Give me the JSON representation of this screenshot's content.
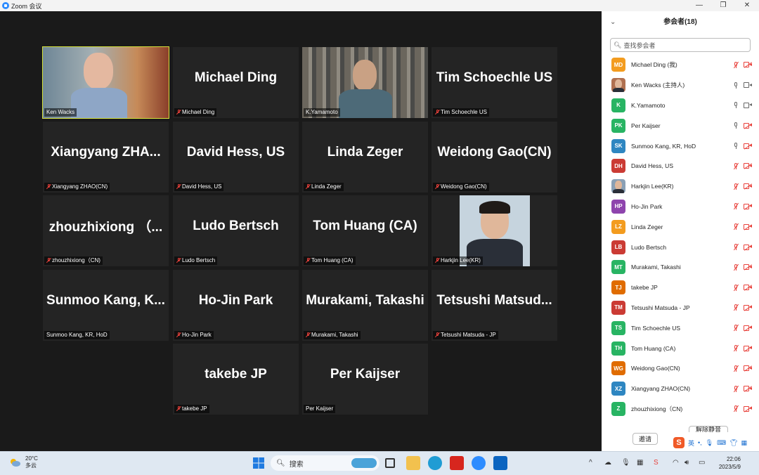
{
  "window": {
    "title": "Zoom 会议",
    "controls": [
      "—",
      "❐",
      "✕"
    ]
  },
  "tiles": [
    {
      "big": "",
      "tag": "Ken Wacks",
      "muted": false,
      "video": "ken"
    },
    {
      "big": "Michael Ding",
      "tag": "Michael Ding",
      "muted": true
    },
    {
      "big": "",
      "tag": "K.Yamamoto",
      "muted": false,
      "video": "yamamoto"
    },
    {
      "big": "Tim Schoechle US",
      "tag": "Tim Schoechle US",
      "muted": true
    },
    {
      "big": "Xiangyang  ZHA...",
      "tag": "Xiangyang ZHAO(CN)",
      "muted": true
    },
    {
      "big": "David Hess, US",
      "tag": "David Hess, US",
      "muted": true
    },
    {
      "big": "Linda Zeger",
      "tag": "Linda Zeger",
      "muted": true
    },
    {
      "big": "Weidong Gao(CN)",
      "tag": "Weidong Gao(CN)",
      "muted": true
    },
    {
      "big": "zhouzhixiong （...",
      "tag": "zhouzhixiong（CN)",
      "muted": true
    },
    {
      "big": "Ludo Bertsch",
      "tag": "Ludo Bertsch",
      "muted": true
    },
    {
      "big": "Tom Huang (CA)",
      "tag": "Tom Huang (CA)",
      "muted": true
    },
    {
      "big": "",
      "tag": "Harkjin Lee(KR)",
      "muted": true,
      "video": "harkjin"
    },
    {
      "big": "Sunmoo  Kang,  K...",
      "tag": "Sunmoo Kang, KR, HoD",
      "muted": false
    },
    {
      "big": "Ho-Jin Park",
      "tag": "Ho-Jin Park",
      "muted": true
    },
    {
      "big": "Murakami, Takashi",
      "tag": "Murakami, Takashi",
      "muted": true
    },
    {
      "big": "Tetsushi  Matsud...",
      "tag": "Tetsushi Matsuda - JP",
      "muted": true
    },
    {
      "big": "takebe JP",
      "tag": "takebe JP",
      "muted": true
    },
    {
      "big": "Per Kaijser",
      "tag": "Per Kaijser",
      "muted": false
    }
  ],
  "sidebar": {
    "title": "参会者(18)",
    "search_placeholder": "查找参会者",
    "participants": [
      {
        "initials": "MD",
        "color": "#f39c1f",
        "name": "Michael Ding (我)",
        "mic": "off",
        "cam": "off"
      },
      {
        "initials": "",
        "color": "#b07050",
        "name": "Ken Wacks (主持人)",
        "mic": "on",
        "cam": "on",
        "photo": true
      },
      {
        "initials": "K",
        "color": "#28b463",
        "name": "K.Yamamoto",
        "mic": "on",
        "cam": "on"
      },
      {
        "initials": "PK",
        "color": "#28b463",
        "name": "Per Kaijser",
        "mic": "on",
        "cam": "off"
      },
      {
        "initials": "SK",
        "color": "#2e86c1",
        "name": "Sunmoo Kang, KR, HoD",
        "mic": "on",
        "cam": "off"
      },
      {
        "initials": "DH",
        "color": "#cb3b34",
        "name": "David Hess, US",
        "mic": "off",
        "cam": "off"
      },
      {
        "initials": "",
        "color": "#8aa0b5",
        "name": "Harkjin Lee(KR)",
        "mic": "off",
        "cam": "off",
        "photo": true
      },
      {
        "initials": "HP",
        "color": "#8e44ad",
        "name": "Ho-Jin Park",
        "mic": "off",
        "cam": "off"
      },
      {
        "initials": "LZ",
        "color": "#f39c1f",
        "name": "Linda Zeger",
        "mic": "off",
        "cam": "off"
      },
      {
        "initials": "LB",
        "color": "#cb3b34",
        "name": "Ludo Bertsch",
        "mic": "off",
        "cam": "off"
      },
      {
        "initials": "MT",
        "color": "#28b463",
        "name": "Murakami, Takashi",
        "mic": "off",
        "cam": "off"
      },
      {
        "initials": "TJ",
        "color": "#e06c00",
        "name": "takebe JP",
        "mic": "off",
        "cam": "off"
      },
      {
        "initials": "TM",
        "color": "#cb3b34",
        "name": "Tetsushi Matsuda - JP",
        "mic": "off",
        "cam": "off"
      },
      {
        "initials": "TS",
        "color": "#28b463",
        "name": "Tim Schoechle US",
        "mic": "off",
        "cam": "off"
      },
      {
        "initials": "TH",
        "color": "#28b463",
        "name": "Tom Huang (CA)",
        "mic": "off",
        "cam": "off"
      },
      {
        "initials": "WG",
        "color": "#e06c00",
        "name": "Weidong Gao(CN)",
        "mic": "off",
        "cam": "off"
      },
      {
        "initials": "XZ",
        "color": "#2e86c1",
        "name": "Xiangyang ZHAO(CN)",
        "mic": "off",
        "cam": "off"
      },
      {
        "initials": "Z",
        "color": "#28b463",
        "name": "zhouzhixiong（CN)",
        "mic": "off",
        "cam": "off"
      }
    ],
    "invite_label": "邀请",
    "unmute_all_label": "解除静音"
  },
  "taskbar": {
    "temp": "20°C",
    "weather": "多云",
    "search_label": "搜索",
    "time": "22:06",
    "date": "2023/5/9",
    "ime": "英"
  }
}
